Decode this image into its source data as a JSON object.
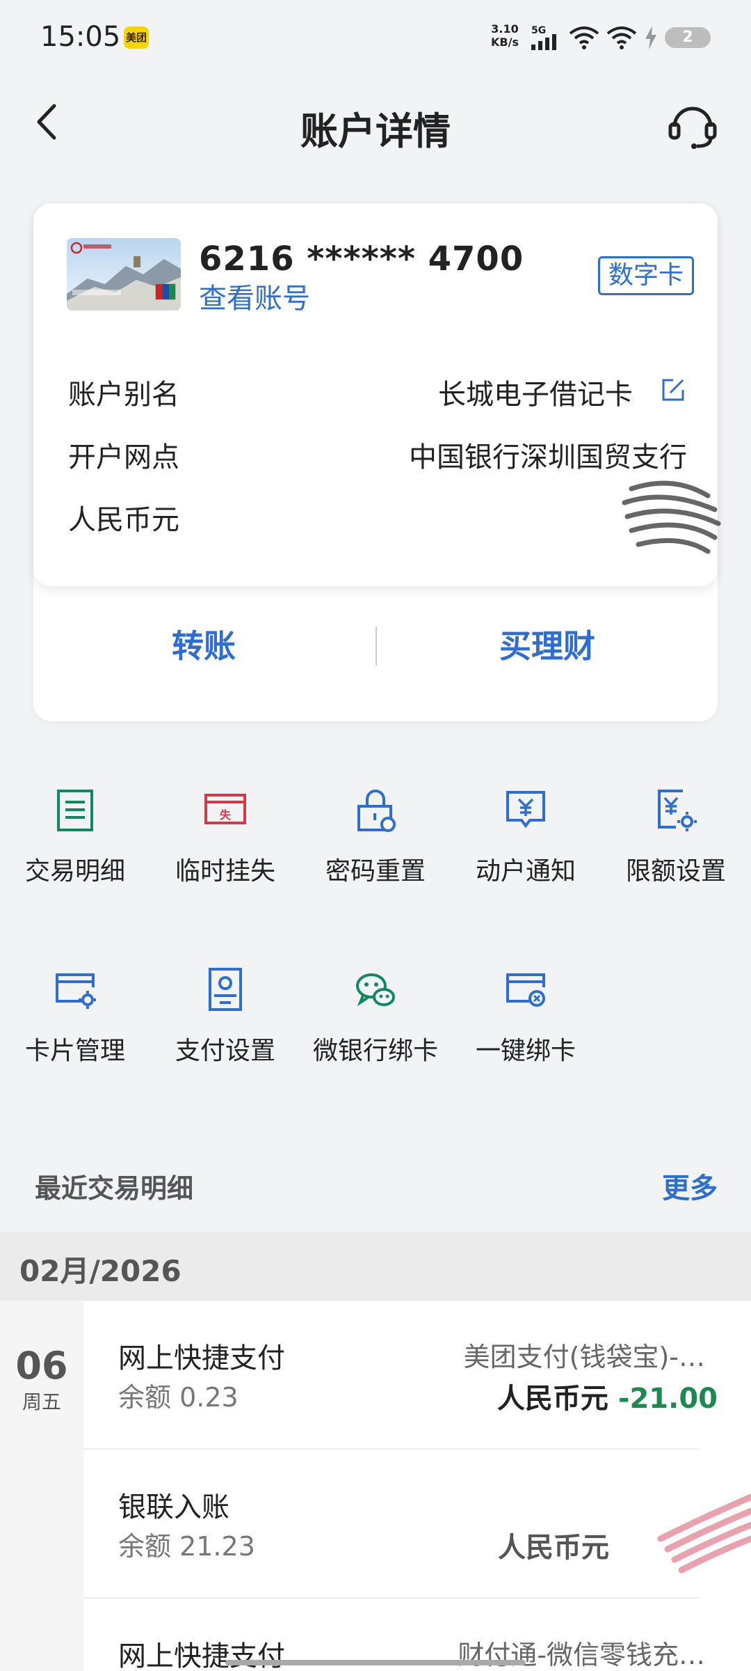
{
  "status_bar": {
    "time": "15:05",
    "app_badge": "美团",
    "speed_value": "3.10",
    "speed_unit": "KB/s",
    "network": "5G",
    "battery": "2"
  },
  "header": {
    "title": "账户详情",
    "back_icon": "chevron-left-icon",
    "service_icon": "headset-icon"
  },
  "card": {
    "number": "6216 ****** 4700",
    "view_account": "查看账号",
    "badge": "数字卡",
    "rows": [
      {
        "label": "账户别名",
        "value": "长城电子借记卡"
      },
      {
        "label": "开户网点",
        "value": "中国银行深圳国贸支行"
      },
      {
        "label": "人民币元",
        "value": ""
      }
    ],
    "actions": [
      "转账",
      "买理财"
    ]
  },
  "grid": [
    {
      "label": "交易明细",
      "icon": "document-list-icon",
      "color": "#0e8a5f"
    },
    {
      "label": "临时挂失",
      "icon": "loss-report-icon",
      "color": "#d23a4a"
    },
    {
      "label": "密码重置",
      "icon": "lock-reset-icon",
      "color": "#2f6ed1"
    },
    {
      "label": "动户通知",
      "icon": "yuan-message-icon",
      "color": "#2f6ed1"
    },
    {
      "label": "限额设置",
      "icon": "yuan-settings-icon",
      "color": "#2f6ed1"
    },
    {
      "label": "卡片管理",
      "icon": "card-settings-icon",
      "color": "#2f6ed1"
    },
    {
      "label": "支付设置",
      "icon": "pay-settings-icon",
      "color": "#2f6ed1"
    },
    {
      "label": "微银行绑卡",
      "icon": "wechat-icon",
      "color": "#0e8a5f"
    },
    {
      "label": "一键绑卡",
      "icon": "card-bind-icon",
      "color": "#2f6ed1"
    }
  ],
  "recent": {
    "title": "最近交易明细",
    "more": "更多",
    "month": "02月/2026",
    "day": "06",
    "weekday": "周五",
    "transactions": [
      {
        "title": "网上快捷支付",
        "balance": "余额 0.23",
        "merchant": "美团支付(钱袋宝)-…",
        "currency": "人民币元",
        "amount": "-21.00"
      },
      {
        "title": "银联入账",
        "balance": "余额 21.23",
        "merchant": "",
        "currency": "人民币元",
        "amount": ""
      },
      {
        "title": "网上快捷支付",
        "balance": "",
        "merchant": "财付通-微信零钱充…",
        "currency": "",
        "amount": ""
      }
    ]
  },
  "colors": {
    "accent": "#2f6ed1",
    "green": "#0e8a5f",
    "red": "#d23a4a",
    "negative_amount": "#1a8a4f"
  }
}
